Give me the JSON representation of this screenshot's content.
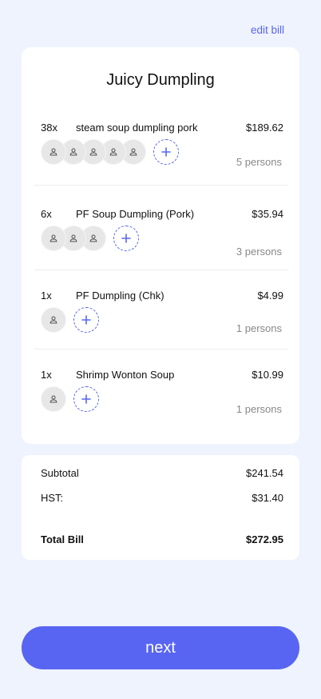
{
  "header": {
    "edit_bill_label": "edit bill"
  },
  "bill": {
    "restaurant": "Juicy Dumpling",
    "items": [
      {
        "qty": "38x",
        "name": "steam soup dumpling pork",
        "price": "$189.62",
        "persons": "5 persons",
        "avatar_count": 5
      },
      {
        "qty": "6x",
        "name": "PF Soup Dumpling (Pork)",
        "price": "$35.94",
        "persons": "3 persons",
        "avatar_count": 3
      },
      {
        "qty": "1x",
        "name": "PF Dumpling (Chk)",
        "price": "$4.99",
        "persons": "1 persons",
        "avatar_count": 1
      },
      {
        "qty": "1x",
        "name": "Shrimp Wonton Soup",
        "price": "$10.99",
        "persons": "1 persons",
        "avatar_count": 1
      }
    ]
  },
  "summary": {
    "subtotal_label": "Subtotal",
    "subtotal_value": "$241.54",
    "tax_label": "HST:",
    "tax_value": "$31.40",
    "total_label": "Total Bill",
    "total_value": "$272.95"
  },
  "footer": {
    "next_label": "next"
  },
  "icons": {
    "avatar": "person-icon",
    "add": "plus-icon"
  },
  "colors": {
    "accent": "#5865f2",
    "background": "#eff3fd",
    "muted": "#888888"
  }
}
